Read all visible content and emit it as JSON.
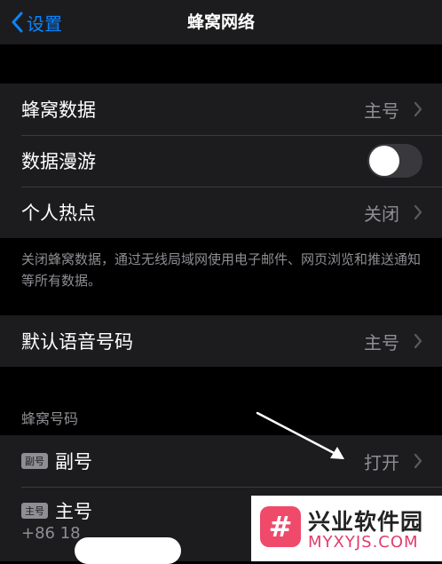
{
  "nav": {
    "back_label": "设置",
    "title": "蜂窝网络"
  },
  "group1": {
    "cellular_data": {
      "label": "蜂窝数据",
      "value": "主号"
    },
    "data_roaming": {
      "label": "数据漫游",
      "on": false
    },
    "hotspot": {
      "label": "个人热点",
      "value": "关闭"
    }
  },
  "note": "关闭蜂窝数据，通过无线局域网使用电子邮件、网页浏览和推送通知等所有数据。",
  "group2": {
    "default_voice": {
      "label": "默认语音号码",
      "value": "主号"
    }
  },
  "cellular_plans": {
    "header": "蜂窝号码",
    "secondary": {
      "badge": "副号",
      "label": "副号",
      "value": "打开"
    },
    "primary": {
      "badge": "主号",
      "label": "主号",
      "number": "+86 18"
    }
  },
  "watermark": {
    "logo_glyph": "#",
    "title": "兴业软件园",
    "url": "MYXYJS.COM"
  },
  "colors": {
    "accent": "#0a84ff",
    "background": "#000000",
    "cell": "#1c1c1e",
    "secondary_text": "#8e8e93"
  }
}
